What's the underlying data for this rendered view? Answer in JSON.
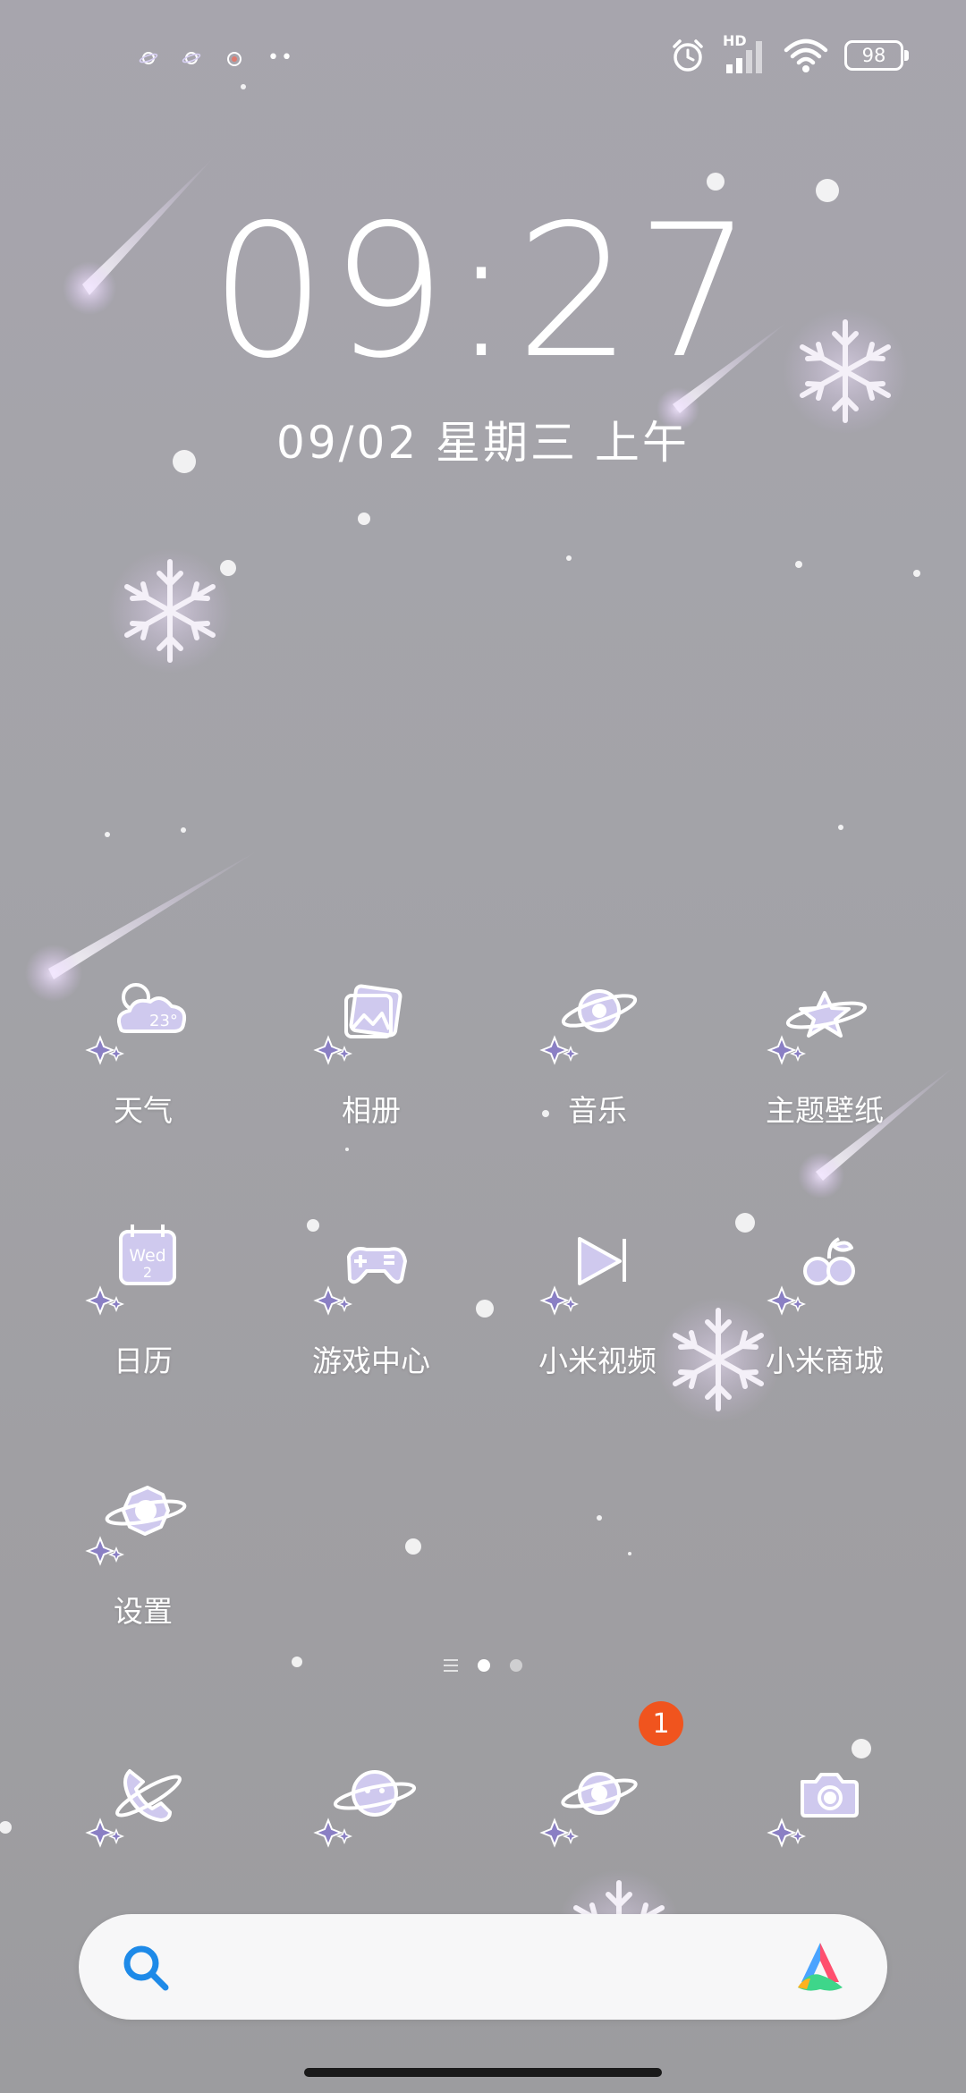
{
  "status_bar": {
    "notification_icons": [
      "planet-notification-icon",
      "planet-notification-icon",
      "app-notification-icon"
    ],
    "more": "••",
    "network_label": "HD",
    "battery": "98",
    "icons": [
      "alarm-icon",
      "signal-icon",
      "wifi-icon",
      "battery-icon"
    ]
  },
  "lockscreen": {
    "time": "09:27",
    "date": "09/02 星期三 上午"
  },
  "apps": [
    {
      "label": "天气",
      "icon": "weather-icon",
      "icon_text": "23°"
    },
    {
      "label": "相册",
      "icon": "gallery-icon"
    },
    {
      "label": "音乐",
      "icon": "music-icon"
    },
    {
      "label": "主题壁纸",
      "icon": "themes-icon"
    },
    {
      "label": "日历",
      "icon": "calendar-icon",
      "icon_text": "Wed",
      "icon_subtext": "2"
    },
    {
      "label": "游戏中心",
      "icon": "game-center-icon"
    },
    {
      "label": "小米视频",
      "icon": "video-icon"
    },
    {
      "label": "小米商城",
      "icon": "mi-store-icon"
    },
    {
      "label": "设置",
      "icon": "settings-icon"
    }
  ],
  "page_indicator": {
    "pages": 2,
    "active": 1
  },
  "dock": [
    {
      "icon": "phone-icon"
    },
    {
      "icon": "messages-icon"
    },
    {
      "icon": "browser-icon",
      "badge": "1"
    },
    {
      "icon": "camera-icon"
    }
  ],
  "colors": {
    "icon_purple": "#8a7fc4",
    "icon_fill": "#cfc9ee",
    "badge": "#f0541e",
    "search_icon": "#1e8ae8"
  }
}
